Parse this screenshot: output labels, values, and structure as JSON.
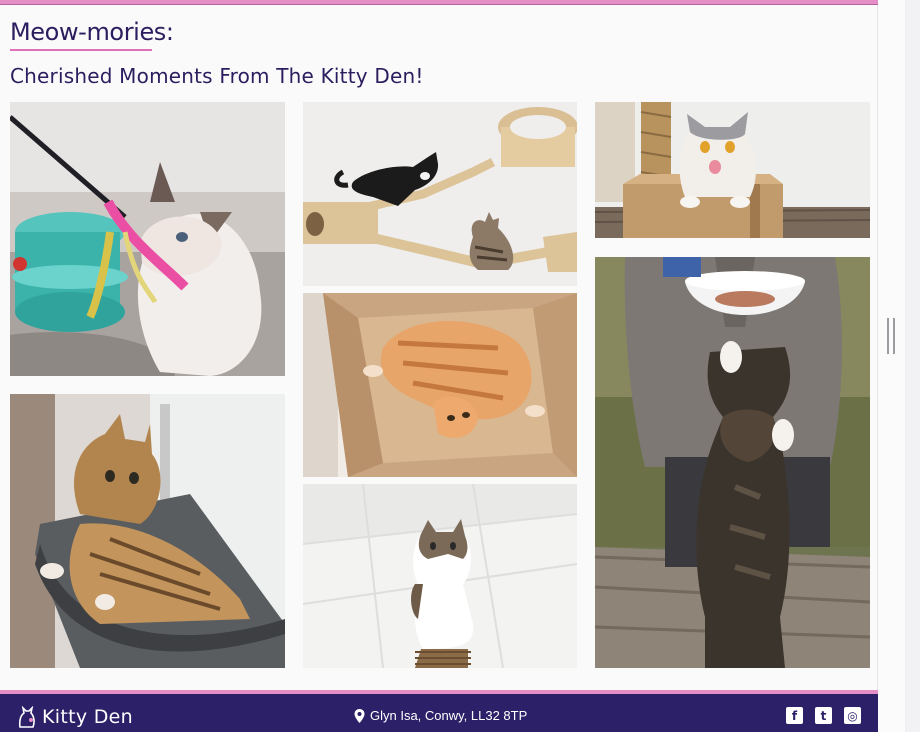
{
  "gallery": {
    "title": "Meow-mories:",
    "subtitle": "Cherished Moments From The Kitty Den!",
    "photos": [
      {
        "alt": "Ragdoll kitten playing with a pink feather toy"
      },
      {
        "alt": "Tabby cat lying in a window hammock"
      },
      {
        "alt": "Black and white cat and tabby cat on wall-mounted cat shelves"
      },
      {
        "alt": "Orange cat playing in a cardboard box"
      },
      {
        "alt": "Tabby and white cat standing on a scratching post"
      },
      {
        "alt": "British shorthair cat licking its lips on a cardboard box"
      },
      {
        "alt": "Fluffy cat reaching up toward a bowl of food held by a person"
      }
    ]
  },
  "footer": {
    "logo_text": "Kitty Den",
    "address": "Glyn Isa, Conwy, LL32 8TP",
    "social": [
      {
        "icon": "facebook-icon",
        "glyph": "f"
      },
      {
        "icon": "twitter-icon",
        "glyph": "t"
      },
      {
        "icon": "instagram-icon",
        "glyph": "◎"
      }
    ]
  },
  "colors": {
    "brand_purple": "#2c2068",
    "accent_pink": "#e58ec6",
    "heading_text": "#2b1d5e"
  }
}
